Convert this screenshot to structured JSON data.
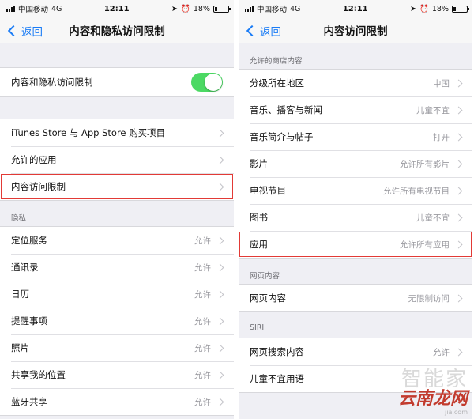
{
  "left": {
    "status": {
      "carrier": "中国移动",
      "network": "4G",
      "time": "12:11",
      "battery": "18%",
      "battery_level": 0.18
    },
    "nav": {
      "back_label": "返回",
      "title": "内容和隐私访问限制"
    },
    "toggle_row": {
      "label": "内容和隐私访问限制",
      "on": true
    },
    "group2": [
      {
        "label": "iTunes Store 与 App Store 购买项目"
      },
      {
        "label": "允许的应用"
      },
      {
        "label": "内容访问限制"
      }
    ],
    "privacy_header": "隐私",
    "privacy": [
      {
        "label": "定位服务",
        "value": "允许"
      },
      {
        "label": "通讯录",
        "value": "允许"
      },
      {
        "label": "日历",
        "value": "允许"
      },
      {
        "label": "提醒事项",
        "value": "允许"
      },
      {
        "label": "照片",
        "value": "允许"
      },
      {
        "label": "共享我的位置",
        "value": "允许"
      },
      {
        "label": "蓝牙共享",
        "value": "允许"
      }
    ]
  },
  "right": {
    "status": {
      "carrier": "中国移动",
      "network": "4G",
      "time": "12:11",
      "battery": "18%",
      "battery_level": 0.18
    },
    "nav": {
      "back_label": "返回",
      "title": "内容访问限制"
    },
    "store_header": "允许的商店内容",
    "store": [
      {
        "label": "分级所在地区",
        "value": "中国"
      },
      {
        "label": "音乐、播客与新闻",
        "value": "儿童不宜"
      },
      {
        "label": "音乐简介与帖子",
        "value": "打开"
      },
      {
        "label": "影片",
        "value": "允许所有影片"
      },
      {
        "label": "电视节目",
        "value": "允许所有电视节目"
      },
      {
        "label": "图书",
        "value": "儿童不宜"
      },
      {
        "label": "应用",
        "value": "允许所有应用"
      }
    ],
    "web_header": "网页内容",
    "web": [
      {
        "label": "网页内容",
        "value": "无限制访问"
      }
    ],
    "siri_header": "SIRI",
    "siri": [
      {
        "label": "网页搜索内容",
        "value": "允许"
      },
      {
        "label": "儿童不宜用语",
        "value": ""
      }
    ]
  },
  "watermark": {
    "top": "智能家",
    "bottom": "云南龙网",
    "url": "jia.com"
  },
  "colors": {
    "accent": "#1a7cf6",
    "toggle_on": "#4cd964",
    "highlight": "#e23a36"
  }
}
